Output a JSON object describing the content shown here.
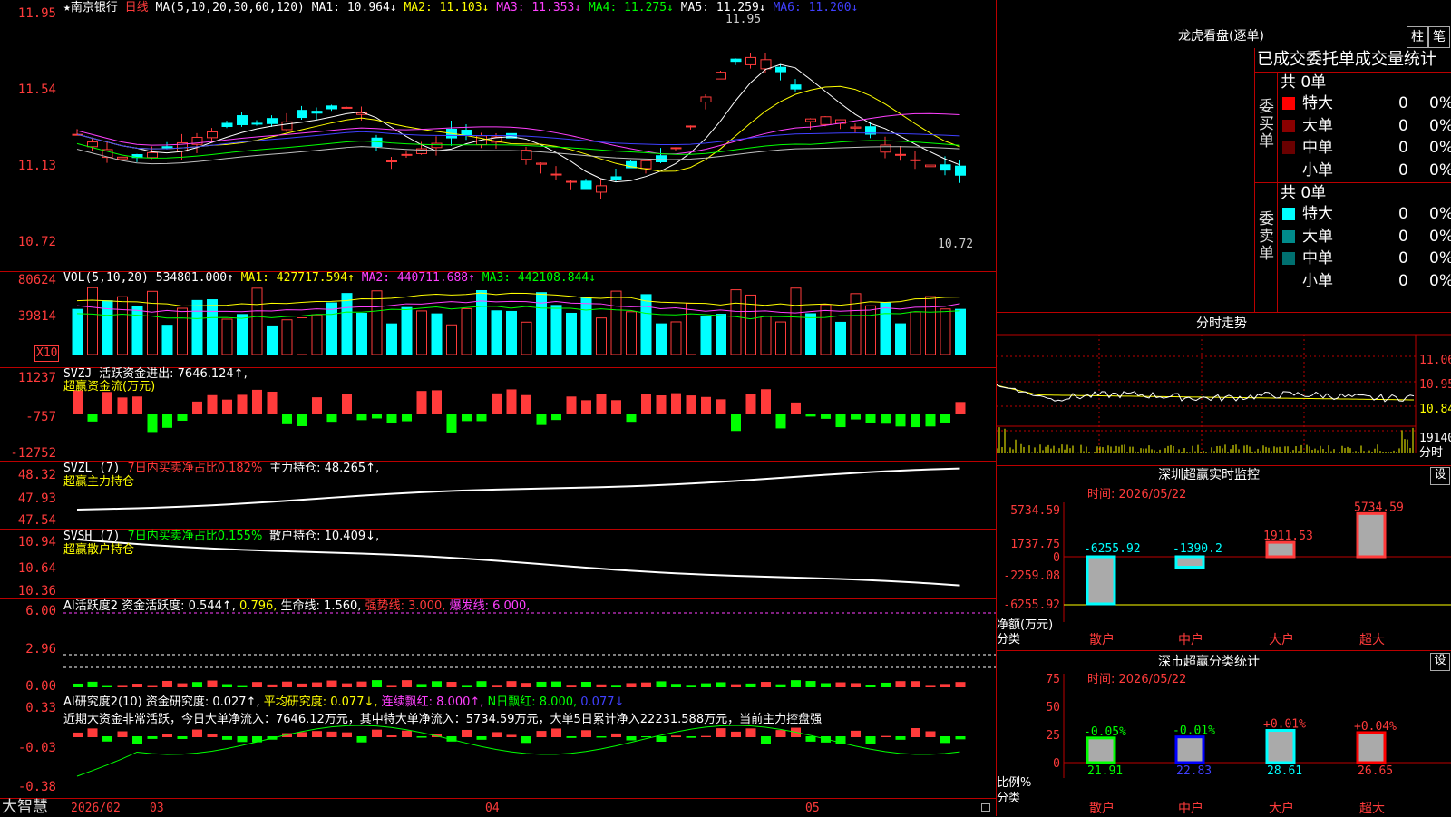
{
  "stock": {
    "star": "★",
    "name": "南京银行",
    "period": "日线"
  },
  "colors": {
    "up": "#ff3b3b",
    "down": "#00ffff",
    "ma1": "#ffffff",
    "ma2": "#ffff00",
    "ma3": "#ff40ff",
    "ma4": "#00ff00",
    "ma5": "#c0c0c0",
    "ma6": "#4040ff"
  },
  "main": {
    "ma_label": "MA(5,10,20,30,60,120)",
    "ma1": "MA1: 10.964↓",
    "ma2": "MA2: 11.103↓",
    "ma3": "MA3: 11.353↓",
    "ma4": "MA4: 11.275↓",
    "ma5": "MA5: 11.259↓",
    "ma6": "MA6: 11.200↓",
    "y_ticks": [
      "11.95",
      "11.54",
      "11.13",
      "10.72"
    ],
    "high_note": "11.95",
    "low_note": "10.72"
  },
  "vol": {
    "label": "VOL(5,10,20)",
    "val": "534801.000↑",
    "ma1": "MA1: 427717.594↑",
    "ma2": "MA2: 440711.688↑",
    "ma3": "MA3: 442108.844↓",
    "y_ticks": [
      "80624",
      "39814"
    ],
    "unit": "X10"
  },
  "svzj": {
    "label": "SVZJ",
    "item": "活跃资金进出: 7646.124↑,",
    "title": "超赢资金流(万元)",
    "y_ticks": [
      "11237",
      "-757",
      "-12752"
    ]
  },
  "svzl": {
    "label": "SVZL (7)",
    "ratio": "7日内买卖净占比0.182%",
    "hold": "主力持仓: 48.265↑,",
    "title": "超赢主力持仓",
    "y_ticks": [
      "48.32",
      "47.93",
      "47.54"
    ]
  },
  "svsh": {
    "label": "SVSH (7)",
    "ratio": "7日内买卖净占比0.155%",
    "hold": "散户持仓: 10.409↓,",
    "title": "超赢散户持仓",
    "y_ticks": [
      "10.94",
      "10.64",
      "10.36"
    ]
  },
  "ai1": {
    "label": "AI活跃度2",
    "a": "资金活跃度: 0.544↑,",
    "b": "0.796,",
    "c": "生命线: 1.560,",
    "d": "强势线: 3.000,",
    "e": "爆发线: 6.000,",
    "y_ticks": [
      "6.00",
      "2.96",
      "0.00"
    ]
  },
  "ai2": {
    "label": "AI研究度2(10)",
    "a": "资金研究度: 0.027↑,",
    "b": "平均研究度: 0.077↓,",
    "c": "连续飘红: 8.000↑,",
    "d": "N日飘红: 8.000,",
    "e": "0.077↓",
    "summary": "近期大资金非常活跃，今日大单净流入：7646.12万元，其中特大单净流入：5734.59万元，大单5日累计净入22231.588万元，当前主力控盘强",
    "y_ticks": [
      "0.33",
      "-0.03",
      "-0.38"
    ]
  },
  "bottom": {
    "brand": "大智慧",
    "dates": [
      "2026/02",
      "03",
      "04",
      "05"
    ]
  },
  "dragon": {
    "title": "龙虎看盘(逐单)",
    "btn1": "柱",
    "btn2": "笔",
    "header": "已成交委托单成交量统计",
    "buy_side": "委买单",
    "sell_side": "委卖单",
    "buy_total": "共 0单",
    "sell_total": "共 0单",
    "buy_rows": [
      {
        "label": "特大",
        "v": "0",
        "p": "0%",
        "c": "#ff0000"
      },
      {
        "label": "大单",
        "v": "0",
        "p": "0%",
        "c": "#8b0000"
      },
      {
        "label": "中单",
        "v": "0",
        "p": "0%",
        "c": "#6a0000"
      },
      {
        "label": "小单",
        "v": "0",
        "p": "0%",
        "c": ""
      }
    ],
    "sell_rows": [
      {
        "label": "特大",
        "v": "0",
        "p": "0%",
        "c": "#00ffff"
      },
      {
        "label": "大单",
        "v": "0",
        "p": "0%",
        "c": "#008b8b"
      },
      {
        "label": "中单",
        "v": "0",
        "p": "0%",
        "c": "#007070"
      },
      {
        "label": "小单",
        "v": "0",
        "p": "0%",
        "c": ""
      }
    ]
  },
  "intraday": {
    "title": "分时走势",
    "y_ticks": [
      "11.06",
      "10.95",
      "10.84"
    ],
    "vol_tick": "19140",
    "vol_label": "分时"
  },
  "realtime": {
    "title": "深圳超赢实时监控",
    "btn": "设",
    "time": "时间: 2026/05/22",
    "y_ticks": [
      "5734.59",
      "1737.75",
      "0",
      "-2259.08",
      "-6255.92"
    ],
    "axis_l1": "净额(万元)",
    "axis_l2": "分类",
    "cats": [
      "散户",
      "中户",
      "大户",
      "超大"
    ],
    "labels": [
      "-6255.92",
      "-1390.2",
      "1911.53",
      "5734.59"
    ]
  },
  "classify": {
    "title": "深市超赢分类统计",
    "btn": "设",
    "time": "时间: 2026/05/22",
    "y_ticks": [
      "75",
      "50",
      "25",
      "0"
    ],
    "axis_l1": "比例%",
    "axis_l2": "分类",
    "cats": [
      "散户",
      "中户",
      "大户",
      "超大"
    ],
    "top": [
      "-0.05%",
      "-0.01%",
      "+0.01%",
      "+0.04%"
    ],
    "bottom": [
      "21.91",
      "22.83",
      "28.61",
      "26.65"
    ]
  }
}
